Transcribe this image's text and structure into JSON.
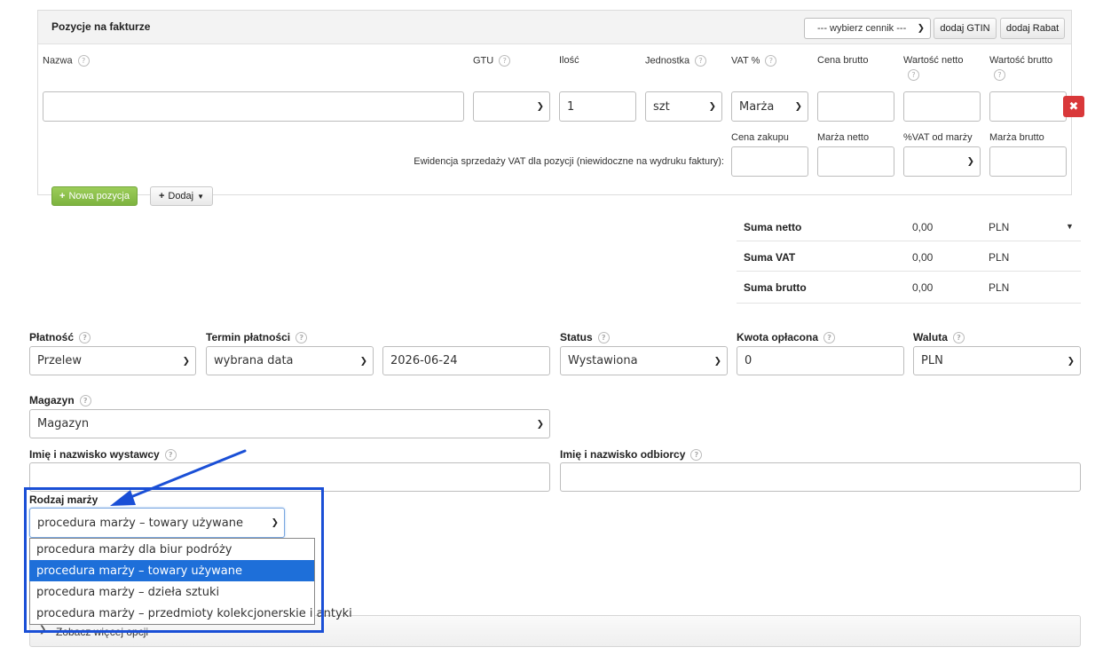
{
  "items_panel": {
    "title": "Pozycje na fakturze",
    "pricelist_select": "--- wybierz cennik ---",
    "add_gtin_label": "dodaj GTIN",
    "add_discount_label": "dodaj Rabat",
    "columns": {
      "name": "Nazwa",
      "gtu": "GTU",
      "quantity": "Ilość",
      "unit": "Jednostka",
      "vat": "VAT %",
      "gross_price": "Cena brutto",
      "net_value": "Wartość netto",
      "gross_value": "Wartość brutto"
    },
    "row": {
      "name_value": "",
      "gtu_value": "",
      "quantity_value": "1",
      "unit_value": "szt",
      "vat_value": "Marża",
      "gross_price_value": "",
      "net_value_value": "",
      "gross_value_value": ""
    },
    "vat_records_label": "Ewidencja sprzedaży VAT dla pozycji (niewidoczne na wydruku faktury):",
    "vat_columns": {
      "purchase_price": "Cena zakupu",
      "net_margin": "Marża netto",
      "vat_from_margin": "%VAT od marży",
      "gross_margin": "Marża brutto"
    },
    "new_item_label": "Nowa pozycja",
    "add_label": "Dodaj"
  },
  "totals": {
    "rows": [
      {
        "label": "Suma netto",
        "value": "0,00",
        "currency": "PLN"
      },
      {
        "label": "Suma VAT",
        "value": "0,00",
        "currency": "PLN"
      },
      {
        "label": "Suma brutto",
        "value": "0,00",
        "currency": "PLN"
      }
    ]
  },
  "form": {
    "payment": {
      "label": "Płatność",
      "value": "Przelew"
    },
    "payment_term": {
      "label": "Termin płatności",
      "value": "wybrana data",
      "date": "2026-06-24"
    },
    "status": {
      "label": "Status",
      "value": "Wystawiona"
    },
    "amount_paid": {
      "label": "Kwota opłacona",
      "value": "0"
    },
    "currency": {
      "label": "Waluta",
      "value": "PLN"
    },
    "warehouse": {
      "label": "Magazyn",
      "value": "Magazyn"
    },
    "issuer_name": {
      "label": "Imię i nazwisko wystawcy",
      "value": ""
    },
    "recipient_name": {
      "label": "Imię i nazwisko odbiorcy",
      "value": ""
    },
    "margin_type": {
      "label": "Rodzaj marży",
      "value": "procedura marży – towary używane",
      "options": [
        "procedura marży dla biur podróży",
        "procedura marży – towary używane",
        "procedura marży – dzieła sztuki",
        "procedura marży – przedmioty kolekcjonerskie i antyki"
      ],
      "selected_index": 1
    },
    "more_options_label": "Zobacz więcej opcji"
  },
  "annotation_color": "#1a4fd6",
  "accent_green": "#8dc34a"
}
